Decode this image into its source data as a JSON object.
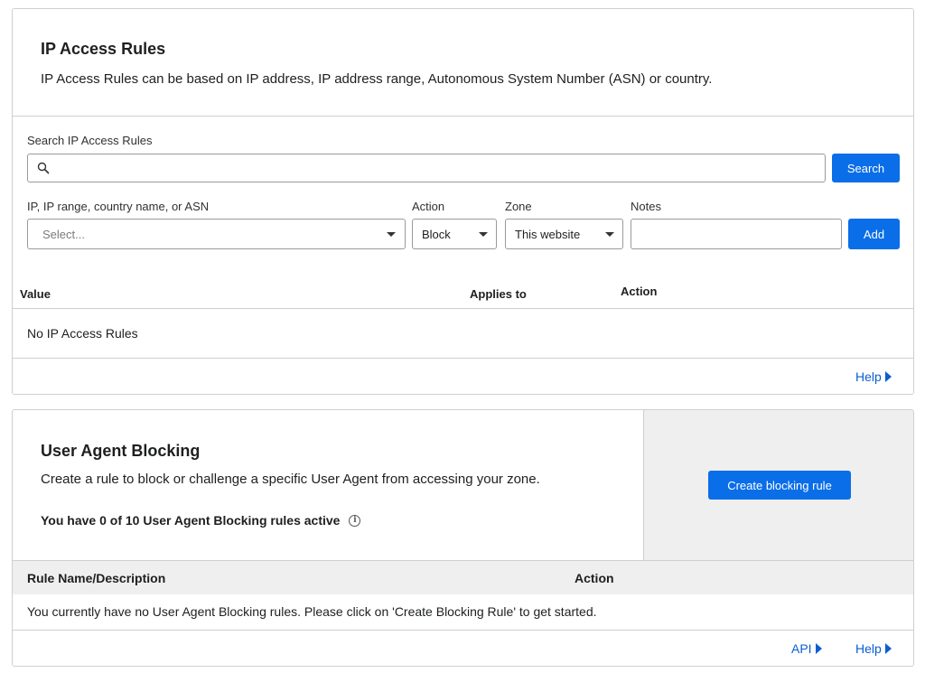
{
  "ip_rules": {
    "title": "IP Access Rules",
    "description": "IP Access Rules can be based on IP address, IP address range, Autonomous System Number (ASN) or country.",
    "search_label": "Search IP Access Rules",
    "search_value": "",
    "search_button": "Search",
    "value_field_label": "IP, IP range, country name, or ASN",
    "value_placeholder": "Select...",
    "action_label": "Action",
    "action_value": "Block",
    "zone_label": "Zone",
    "zone_value": "This website",
    "notes_label": "Notes",
    "notes_value": "",
    "add_button": "Add",
    "table": {
      "columns": [
        "Value",
        "Applies to",
        "Action"
      ],
      "empty_text": "No IP Access Rules"
    },
    "help_link": "Help"
  },
  "ua_blocking": {
    "title": "User Agent Blocking",
    "description": "Create a rule to block or challenge a specific User Agent from accessing your zone.",
    "active_count_text": "You have 0 of 10 User Agent Blocking rules active",
    "create_button": "Create blocking rule",
    "table": {
      "columns": [
        "Rule Name/Description",
        "Action"
      ],
      "empty_text": "You currently have no User Agent Blocking rules. Please click on 'Create Blocking Rule' to get started."
    },
    "api_link": "API",
    "help_link": "Help"
  },
  "colors": {
    "accent": "#0a6ee8",
    "link": "#0a5fd1",
    "border": "#cfcfcf",
    "panel_gray": "#efefef"
  },
  "icons": {
    "search": "search-icon",
    "caret": "chevron-down-icon",
    "info": "info-icon",
    "arrow": "triangle-right-icon"
  }
}
